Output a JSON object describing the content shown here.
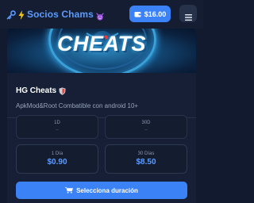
{
  "header": {
    "brand_title": "Socios Chams",
    "balance_label": "$16.00"
  },
  "product": {
    "banner_text": "CHEATS",
    "title": "HG Cheats",
    "description": "ApkMod&Root Combatible con android 10+",
    "durations": [
      {
        "label": "1D",
        "value": "--"
      },
      {
        "label": "30D",
        "value": "--"
      }
    ],
    "prices": [
      {
        "days": "1 Día",
        "amount": "$0.90"
      },
      {
        "days": "30 Días",
        "amount": "$8.50"
      }
    ],
    "cta_label": "Selecciona duración"
  },
  "colors": {
    "accent": "#3b82f6",
    "background": "#111a2e",
    "card": "#161f35",
    "price_text": "#5b9bff"
  }
}
